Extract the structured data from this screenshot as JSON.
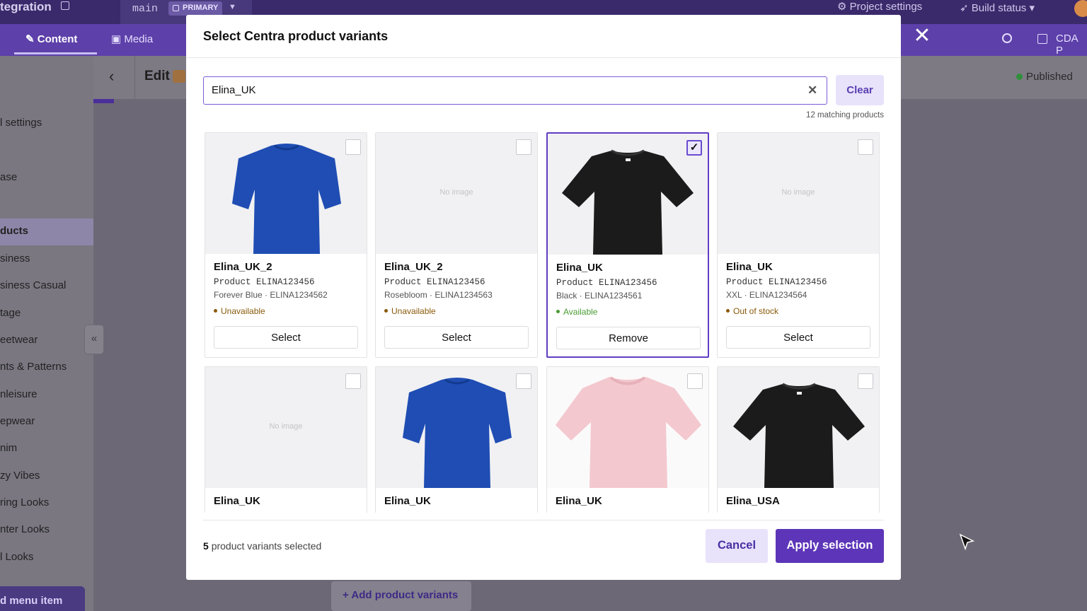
{
  "app": {
    "brand": "tegration",
    "branch": "main",
    "branch_badge": "PRIMARY",
    "project_settings": "Project settings",
    "build_status": "Build status",
    "tabs": [
      {
        "label": "Content"
      },
      {
        "label": "Media"
      }
    ],
    "cda": "CDA P",
    "edit_title": "Edit",
    "published": "Published",
    "add_variants": "+ Add product variants",
    "sidebar": {
      "items": [
        {
          "label": "l settings"
        },
        {
          "label": "ase"
        },
        {
          "label": "ducts"
        },
        {
          "label": "siness"
        },
        {
          "label": "siness Casual"
        },
        {
          "label": "tage"
        },
        {
          "label": "eetwear"
        },
        {
          "label": "nts & Patterns"
        },
        {
          "label": "nleisure"
        },
        {
          "label": "epwear"
        },
        {
          "label": "nim"
        },
        {
          "label": "zy Vibes"
        },
        {
          "label": "ring Looks"
        },
        {
          "label": "nter Looks"
        },
        {
          "label": "l Looks"
        }
      ],
      "add_menu_item": "d menu item"
    }
  },
  "modal": {
    "title": "Select Centra product variants",
    "search_value": "Elina_UK",
    "clear_label": "Clear",
    "matching": "12 matching products",
    "no_image": "No image",
    "products": [
      {
        "name": "Elina_UK_2",
        "product": "Product ELINA123456",
        "variant": "Forever Blue · ELINA1234562",
        "status": "Unavailable",
        "action": "Select"
      },
      {
        "name": "Elina_UK_2",
        "product": "Product ELINA123456",
        "variant": "Rosebloom · ELINA1234563",
        "status": "Unavailable",
        "action": "Select"
      },
      {
        "name": "Elina_UK",
        "product": "Product ELINA123456",
        "variant": "Black · ELINA1234561",
        "status": "Available",
        "action": "Remove",
        "check": "✓"
      },
      {
        "name": "Elina_UK",
        "product": "Product ELINA123456",
        "variant": "XXL · ELINA1234564",
        "status": "Out of stock",
        "action": "Select"
      },
      {
        "name": "Elina_UK"
      },
      {
        "name": "Elina_UK"
      },
      {
        "name": "Elina_UK"
      },
      {
        "name": "Elina_USA"
      }
    ],
    "selected_count": "5",
    "selected_text": "product variants selected",
    "cancel": "Cancel",
    "apply": "Apply selection"
  },
  "colors": {
    "accent": "#5d35b8",
    "accent_light": "#e8e2fb",
    "available": "#4a9b33",
    "unavailable": "#8a5a0a",
    "shirt_blue": "#1f4db3",
    "shirt_black": "#1b1b1b",
    "shirt_pink": "#f3c8cf"
  }
}
